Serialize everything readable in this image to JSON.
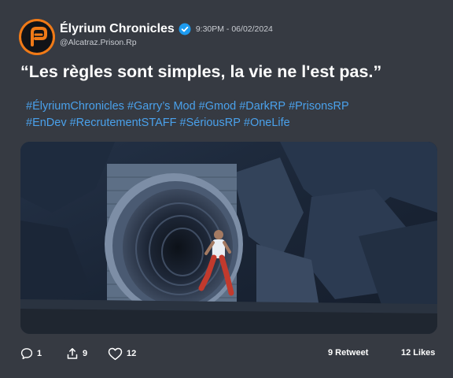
{
  "post": {
    "author_name": "Élyrium Chronicles",
    "handle": "@Alcatraz.Prison.Rp",
    "timestamp": "9:30PM - 06/02/2024",
    "verified": true,
    "quote": "“Les règles sont simples, la vie ne l'est pas.”",
    "hashtags_line1": [
      "#ÉlyriumChronicles",
      "#Garry’s Mod",
      "#Gmod",
      "#DarkRP",
      "#PrisonsRP"
    ],
    "hashtags_line2": [
      "#EnDev",
      "#RecrutementSTAFF",
      "#SériousRP",
      "#OneLife"
    ],
    "media_icon": "game-screenshot-tunnel-escape"
  },
  "actions": {
    "replies": "1",
    "shares": "9",
    "likes": "12",
    "retweet_stat": "9 Retweet",
    "likes_stat": "12 Likes"
  },
  "colors": {
    "background": "#363a42",
    "accent_link": "#4aa1eb",
    "avatar_bg": "#f07a17",
    "verified_badge": "#1d9bf0"
  }
}
